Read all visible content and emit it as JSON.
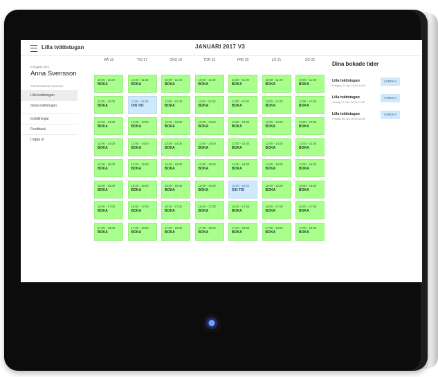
{
  "app": {
    "title": "Lilla tvättstugan",
    "month_title": "JANUARI 2017 V3"
  },
  "sidebar": {
    "logged_in_label": "Inloggad som",
    "user_name": "Anna Svensson",
    "section_label": "Gemensamma resurser",
    "items": [
      {
        "label": "Lilla tvättstugan",
        "active": true
      },
      {
        "label": "Stora tvättstugan",
        "active": false
      },
      {
        "label": "Inställningar",
        "active": false
      },
      {
        "label": "Feedback",
        "active": false
      },
      {
        "label": "Logga ut",
        "active": false
      }
    ]
  },
  "calendar": {
    "days": [
      "MÅ 16",
      "TIS 17",
      "ONS 18",
      "TOR 19",
      "FRE 20",
      "LÖ 21",
      "SÖ 22"
    ],
    "times": [
      "10:00 - 11:00",
      "11:00 - 12:00",
      "12:00 - 13:00",
      "13:00 - 14:00",
      "14:00 - 15:00",
      "15:00 - 16:00",
      "16:00 - 17:00",
      "17:00 - 18:00"
    ],
    "book_label": "BOKA",
    "mine_label": "DIN TID",
    "booked_slots": [
      {
        "day": 1,
        "time": 1
      },
      {
        "day": 4,
        "time": 5
      }
    ]
  },
  "bookings": {
    "title": "Dina bokade tider",
    "cancel_label": "AVBOKA",
    "items": [
      {
        "name": "Lilla tvättstugan",
        "date": "Fredag 13 Jan 13:00-14:00"
      },
      {
        "name": "Lilla tvättstugan",
        "date": "Tisdag 17 Jan 11:00-12:00"
      },
      {
        "name": "Lilla tvättstugan",
        "date": "Fredag 20 Jan 15:00-16:00"
      }
    ]
  },
  "colors": {
    "slot_free": "#a8ff8c",
    "slot_mine": "#cfe8fb",
    "device": "#0c0c0d"
  }
}
